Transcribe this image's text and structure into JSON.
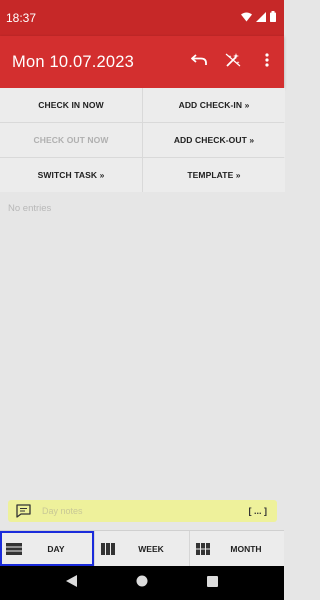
{
  "status_bar": {
    "time": "18:37"
  },
  "app_bar": {
    "title": "Mon 10.07.2023"
  },
  "actions": [
    {
      "name": "undo-icon"
    },
    {
      "name": "magic-wand-icon"
    },
    {
      "name": "more-vert-icon"
    }
  ],
  "buttons": {
    "check_in_now": "CHECK IN NOW",
    "add_check_in": "ADD CHECK-IN »",
    "check_out_now": "CHECK OUT NOW",
    "add_check_out": "ADD CHECK-OUT »",
    "switch_task": "SWITCH TASK »",
    "template": "TEMPLATE »"
  },
  "entries": {
    "empty_text": "No entries"
  },
  "notes": {
    "placeholder": "Day notes",
    "expand": "[ ... ]"
  },
  "tabs": {
    "day": "DAY",
    "week": "WEEK",
    "month": "MONTH",
    "active": "day"
  },
  "colors": {
    "status_bar": "#c62828",
    "app_bar": "#d32f2f",
    "notes_bg": "#eef19b",
    "active_outline": "#1a2bdb"
  }
}
